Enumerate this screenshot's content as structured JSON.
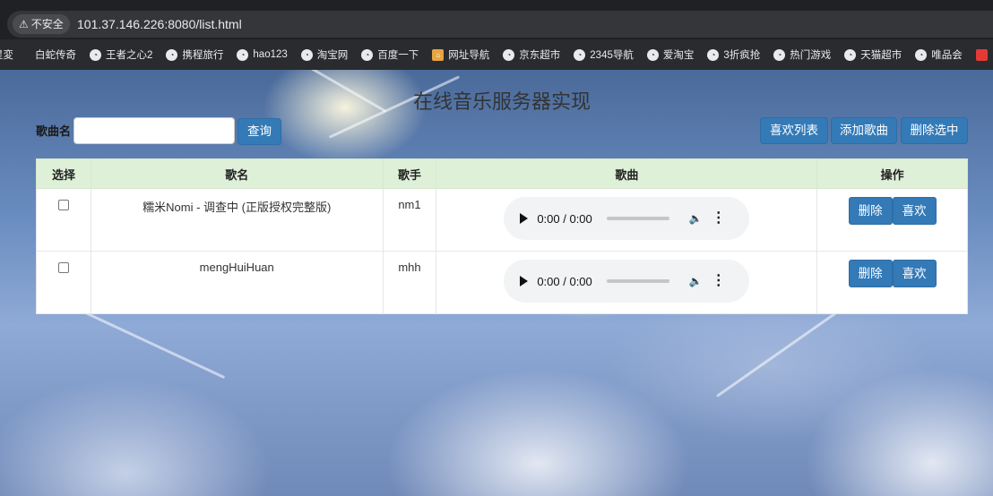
{
  "browser": {
    "security_warning_icon": "warning-triangle-icon",
    "security_label": "不安全",
    "url": "101.37.146.226:8080/list.html",
    "bookmarks": [
      {
        "label": "星変",
        "icon": ""
      },
      {
        "label": "白蛇传奇",
        "icon": ""
      },
      {
        "label": "王者之心2",
        "icon": "globe-icon"
      },
      {
        "label": "携程旅行",
        "icon": "globe-icon"
      },
      {
        "label": "hao123",
        "icon": "globe-icon"
      },
      {
        "label": "淘宝网",
        "icon": "globe-icon"
      },
      {
        "label": "百度一下",
        "icon": "globe-icon"
      },
      {
        "label": "网址导航",
        "icon": "house-icon"
      },
      {
        "label": "京东超市",
        "icon": "globe-icon"
      },
      {
        "label": "2345导航",
        "icon": "globe-icon"
      },
      {
        "label": "爱淘宝",
        "icon": "globe-icon"
      },
      {
        "label": "3折疯抢",
        "icon": "globe-icon"
      },
      {
        "label": "热门游戏",
        "icon": "globe-icon"
      },
      {
        "label": "天猫超市",
        "icon": "globe-icon"
      },
      {
        "label": "唯品会",
        "icon": "globe-icon"
      }
    ]
  },
  "page": {
    "title": "在线音乐服务器实现",
    "search": {
      "label": "歌曲名",
      "value": "",
      "placeholder": "",
      "button": "查询"
    },
    "actions": {
      "like_list": "喜欢列表",
      "add_song": "添加歌曲",
      "delete_selected": "删除选中"
    }
  },
  "table": {
    "headers": {
      "select": "选择",
      "name": "歌名",
      "singer": "歌手",
      "song": "歌曲",
      "ops": "操作"
    },
    "rows": [
      {
        "checked": false,
        "name": "糯米Nomi - 调查中 (正版授权完整版)",
        "singer": "nm1",
        "time": "0:00 / 0:00",
        "delete": "删除",
        "like": "喜欢"
      },
      {
        "checked": false,
        "name": "mengHuiHuan",
        "singer": "mhh",
        "time": "0:00 / 0:00",
        "delete": "删除",
        "like": "喜欢"
      }
    ]
  },
  "colors": {
    "primary_button": "#337ab7",
    "table_header_bg": "#dff0d8",
    "browser_chrome": "#202124"
  }
}
